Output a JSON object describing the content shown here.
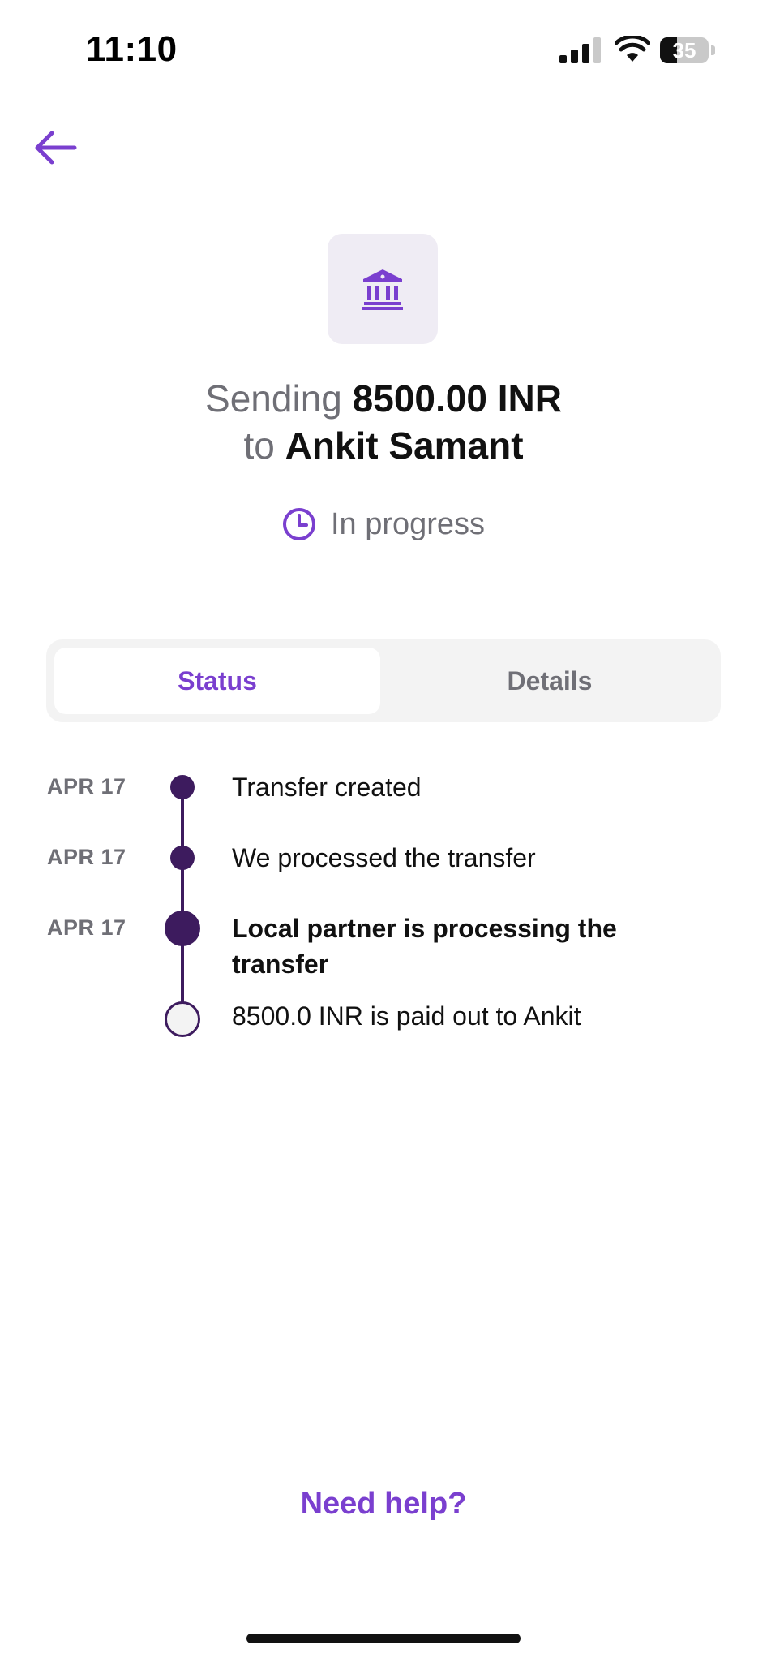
{
  "status_bar": {
    "time": "11:10",
    "battery_percent": "35",
    "battery_level": 0.35
  },
  "header": {
    "back_icon": "arrow-left-icon",
    "bank_icon": "bank-icon"
  },
  "transfer": {
    "prefix": "Sending",
    "amount": "8500.00 INR",
    "connector": "to",
    "recipient": "Ankit Samant",
    "status_icon": "clock-icon",
    "status": "In progress"
  },
  "tabs": [
    {
      "label": "Status",
      "active": true
    },
    {
      "label": "Details",
      "active": false
    }
  ],
  "timeline": [
    {
      "date": "APR 17",
      "text": "Transfer created",
      "state": "done"
    },
    {
      "date": "APR 17",
      "text": "We processed the transfer",
      "state": "done"
    },
    {
      "date": "APR 17",
      "text": "Local partner is processing the transfer",
      "state": "current"
    },
    {
      "date": "",
      "text": "8500.0 INR is paid out to Ankit",
      "state": "pending"
    }
  ],
  "help": {
    "label": "Need help?"
  },
  "colors": {
    "accent": "#7a3fcf",
    "timeline": "#3d1b5e",
    "muted_text": "#6f6f76",
    "tile_bg": "#efecf4"
  }
}
